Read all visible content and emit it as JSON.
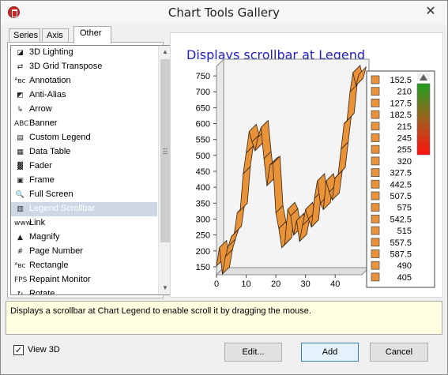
{
  "window": {
    "title": "Chart Tools Gallery",
    "close_symbol": "✕"
  },
  "tabs": [
    {
      "label": "Series",
      "active": false
    },
    {
      "label": "Axis",
      "active": false
    },
    {
      "label": "Other",
      "active": true
    }
  ],
  "tools": [
    {
      "label": "3D Lighting",
      "icon": "3d-lighting-icon",
      "glyph": "◪"
    },
    {
      "label": "3D Grid Transpose",
      "icon": "grid-transpose-icon",
      "glyph": "⇄"
    },
    {
      "label": "Annotation",
      "icon": "annotation-icon",
      "glyph": "ᴬʙᴄ"
    },
    {
      "label": "Anti-Alias",
      "icon": "anti-alias-icon",
      "glyph": "◩"
    },
    {
      "label": "Arrow",
      "icon": "arrow-icon",
      "glyph": "↳"
    },
    {
      "label": "Banner",
      "icon": "banner-icon",
      "glyph": "ABC"
    },
    {
      "label": "Custom Legend",
      "icon": "custom-legend-icon",
      "glyph": "▤"
    },
    {
      "label": "Data Table",
      "icon": "data-table-icon",
      "glyph": "▦"
    },
    {
      "label": "Fader",
      "icon": "fader-icon",
      "glyph": "▓"
    },
    {
      "label": "Frame",
      "icon": "frame-icon",
      "glyph": "▣"
    },
    {
      "label": "Full Screen",
      "icon": "magnifier-icon",
      "glyph": "🔍"
    },
    {
      "label": "Legend Scrollbar",
      "icon": "legend-scrollbar-icon",
      "glyph": "▥",
      "selected": true
    },
    {
      "label": "Link",
      "icon": "link-icon",
      "glyph": "www"
    },
    {
      "label": "Magnify",
      "icon": "magnify-icon",
      "glyph": "▲"
    },
    {
      "label": "Page Number",
      "icon": "page-number-icon",
      "glyph": "#"
    },
    {
      "label": "Rectangle",
      "icon": "rectangle-icon",
      "glyph": "ᴬʙᴄ"
    },
    {
      "label": "Repaint Monitor",
      "icon": "fps-icon",
      "glyph": "FPS"
    },
    {
      "label": "Rotate",
      "icon": "rotate-icon",
      "glyph": "↻"
    }
  ],
  "preview": {
    "title": "Displays scrollbar at Legend"
  },
  "chart_data": {
    "type": "line",
    "title": "Displays scrollbar at Legend",
    "x": [
      0,
      1,
      2,
      3,
      4,
      5,
      6,
      7,
      8,
      9,
      10,
      11,
      12,
      13,
      14,
      15,
      16,
      17,
      18,
      19,
      20,
      21,
      22,
      23,
      24,
      25,
      26,
      27,
      28,
      29,
      30,
      31,
      32,
      33,
      34,
      35,
      36,
      37,
      38,
      39,
      40,
      41,
      42,
      43,
      44,
      45,
      46,
      47,
      48
    ],
    "values": [
      152.5,
      210,
      127.5,
      182.5,
      215,
      245,
      255,
      320,
      327.5,
      442.5,
      507.5,
      575,
      542.5,
      515,
      557.5,
      587.5,
      490,
      405,
      470,
      475,
      320,
      270,
      210,
      220,
      330,
      310,
      250,
      295,
      230,
      280,
      330,
      300,
      275,
      365,
      420,
      350,
      330,
      420,
      385,
      360,
      430,
      440,
      520,
      600,
      610,
      700,
      760,
      720,
      755
    ],
    "xlim": [
      0,
      49
    ],
    "ylim": [
      125,
      780
    ],
    "x_ticks": [
      "0",
      "10",
      "20",
      "30",
      "40"
    ],
    "y_ticks": [
      "150",
      "200",
      "250",
      "300",
      "350",
      "400",
      "450",
      "500",
      "550",
      "600",
      "650",
      "700",
      "750"
    ],
    "legend_entries": [
      "152.5",
      "210",
      "127.5",
      "182.5",
      "215",
      "245",
      "255",
      "320",
      "327.5",
      "442.5",
      "507.5",
      "575",
      "542.5",
      "515",
      "557.5",
      "587.5",
      "490",
      "405"
    ],
    "legend_placement": "right",
    "series_color": "#e8923a",
    "grid": true
  },
  "description": "Displays a scrollbar at Chart Legend to enable scroll it by dragging the mouse.",
  "view3d": {
    "label": "View 3D",
    "checked": true
  },
  "buttons": {
    "edit": "Edit...",
    "add": "Add",
    "cancel": "Cancel"
  },
  "scroll_glyphs": {
    "up": "▲",
    "down": "▼"
  }
}
